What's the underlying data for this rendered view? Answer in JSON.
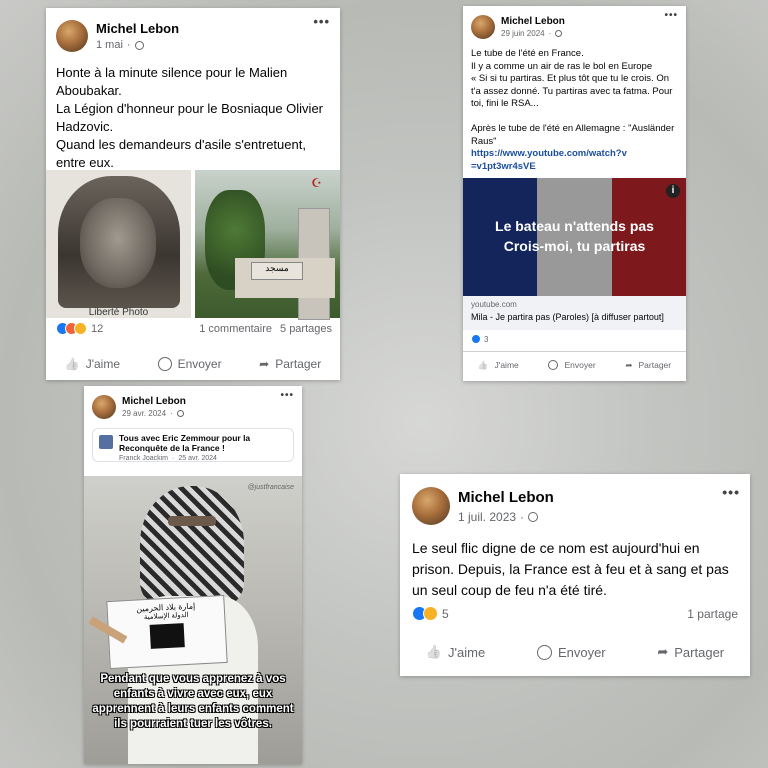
{
  "post1": {
    "author": "Michel Lebon",
    "date": "1 mai",
    "text": "Honte à la minute silence pour le Malien Aboubakar.\nLa Légion d'honneur pour le Bosniaque Olivier Hadzovic.\nQuand les demandeurs d'asile s'entretuent, entre eux.",
    "photo_caption": "Liberté Photo",
    "sign_text": "مسجد",
    "reaction_count": "12",
    "comments": "1 commentaire",
    "shares": "5 partages",
    "like_label": "J'aime",
    "send_label": "Envoyer",
    "share_label": "Partager"
  },
  "post2": {
    "author": "Michel Lebon",
    "date": "29 juin 2024",
    "text": "Le tube de l'été en France.\nIl y a comme un air de ras le bol en Europe\n« Si si tu partiras. Et plus tôt que tu le crois. On t'a assez donné. Tu partiras avec ta fatma. Pour toi, fini le RSA...\n\nAprès le tube de l'été en Allemagne : \"Ausländer Raus\"",
    "link_text": "https://www.youtube.com/watch?v=v1pt3wr4sVE",
    "video_line1": "Le bateau n'attends pas",
    "video_line2": "Crois-moi, tu partiras",
    "link_domain": "youtube.com",
    "link_title": "Mila - Je partira pas (Paroles) [à diffuser partout]",
    "reaction_count": "3",
    "like_label": "J'aime",
    "send_label": "Envoyer",
    "share_label": "Partager"
  },
  "post3": {
    "author": "Michel Lebon",
    "date": "29 avr. 2024",
    "shared_title": "Tous avec Eric Zemmour pour la Reconquête de la France !",
    "shared_author": "Franck Joackim",
    "shared_date": "25 avr. 2024",
    "watermark": "@justfrancaise",
    "sign_line1": "إمارة بلاد الحرمين",
    "sign_line2": "الدولة الإسلامية",
    "caption": "Pendant que vous apprenez à vos enfants à vivre avec eux, eux apprennent à leurs enfants comment ils pourraient tuer les vôtres."
  },
  "post4": {
    "author": "Michel Lebon",
    "date": "1 juil. 2023",
    "text": "Le seul flic digne de ce nom est aujourd'hui en prison. Depuis, la France est à feu et à sang et pas un seul coup de feu n'a été tiré.",
    "reaction_count": "5",
    "shares": "1 partage",
    "like_label": "J'aime",
    "send_label": "Envoyer",
    "share_label": "Partager"
  },
  "colors": {
    "link": "#1b4ea0",
    "like": "#1877f2",
    "meta": "#65676b"
  },
  "icons": [
    "more-icon",
    "globe-icon",
    "like-icon",
    "messenger-icon",
    "share-icon",
    "info-icon"
  ]
}
